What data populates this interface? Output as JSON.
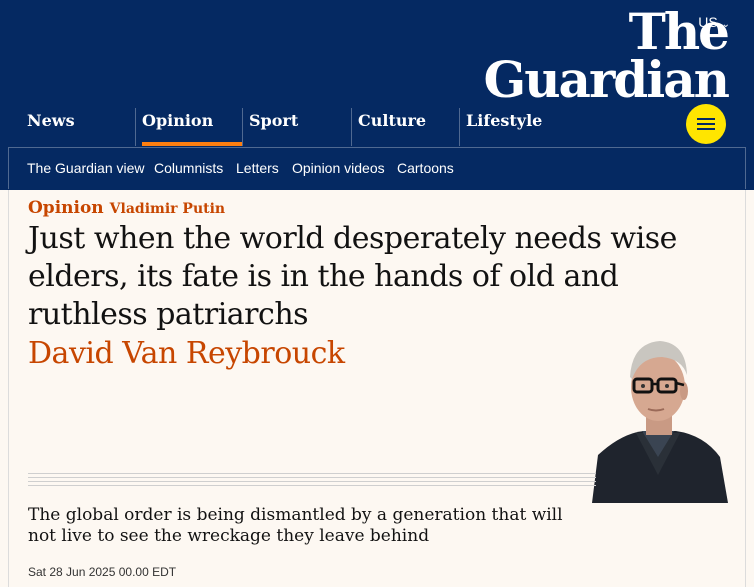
{
  "header": {
    "edition": "US",
    "logo_line1": "The",
    "logo_line2": "Guardian",
    "pillars": [
      {
        "label": "News"
      },
      {
        "label": "Opinion"
      },
      {
        "label": "Sport"
      },
      {
        "label": "Culture"
      },
      {
        "label": "Lifestyle"
      }
    ],
    "active_pillar": "Opinion",
    "subnav": [
      "The Guardian view",
      "Columnists",
      "Letters",
      "Opinion videos",
      "Cartoons"
    ],
    "colors": {
      "brand": "#052962",
      "accent": "#ff7f0f",
      "menu": "#ffe500",
      "opinion": "#c74600"
    }
  },
  "article": {
    "section": "Opinion",
    "topic": "Vladimir Putin",
    "headline": "Just when the world desperately needs wise elders, its fate is in the hands of old and ruthless patriarchs",
    "author": "David Van Reybrouck",
    "standfirst": "The global order is being dismantled by a generation that will not live to see the wreckage they leave behind",
    "date": "Sat 28 Jun 2025 00.00 EDT",
    "image_icon": "author-portrait"
  }
}
